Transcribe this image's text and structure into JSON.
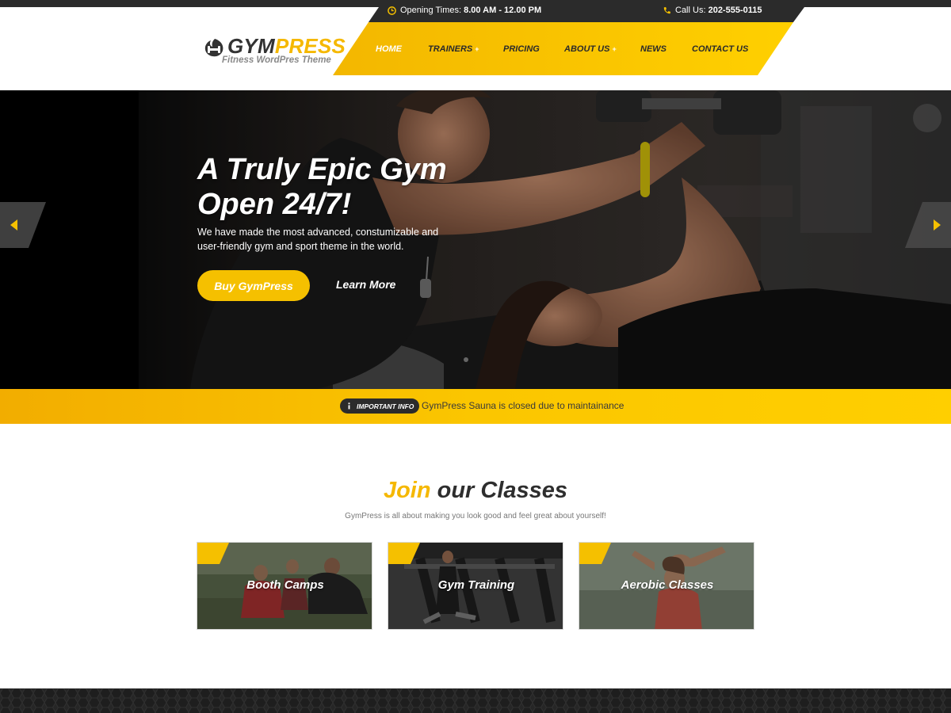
{
  "colors": {
    "accent": "#f5c000",
    "dark": "#2b2b2b",
    "nav_active": "#ffffff"
  },
  "brand": {
    "name_dark": "GYM",
    "name_accent": "PRESS",
    "tagline": "Fitness WordPres Theme",
    "logo_icon": "dumbbell-flame-icon"
  },
  "topbar": {
    "opening_label": "Opening Times:",
    "opening_value": "8.00 AM - 12.00 PM",
    "opening_icon": "clock-icon",
    "call_label": "Call Us:",
    "call_value": "202-555-0115",
    "call_icon": "phone-icon"
  },
  "nav": {
    "items": [
      {
        "label": "Home",
        "active": true,
        "submenu": false
      },
      {
        "label": "Trainers",
        "active": false,
        "submenu": true
      },
      {
        "label": "Pricing",
        "active": false,
        "submenu": false
      },
      {
        "label": "About us",
        "active": false,
        "submenu": true
      },
      {
        "label": "News",
        "active": false,
        "submenu": false
      },
      {
        "label": "Contact us",
        "active": false,
        "submenu": false
      }
    ],
    "submenu_marker": "+"
  },
  "hero": {
    "title_line1": "A Truly Epic Gym",
    "title_line2": "Open 24/7!",
    "text": "We have made the most advanced, constumizable and user-friendly gym and sport theme in the world.",
    "primary_button": "Buy GymPress",
    "secondary_button": "Learn More",
    "prev_icon": "arrow-left-icon",
    "next_icon": "arrow-right-icon"
  },
  "notice": {
    "badge": "IMPORTANT INFO",
    "badge_icon": "info-icon",
    "text": "GymPress Sauna is closed due to maintainance"
  },
  "classes": {
    "title_accent": "Join",
    "title_rest": "our Classes",
    "subtitle": "GymPress is all about making you look good and feel great about yourself!",
    "cards": [
      {
        "label": "Booth Camps"
      },
      {
        "label": "Gym Training"
      },
      {
        "label": "Aerobic Classes"
      }
    ]
  }
}
